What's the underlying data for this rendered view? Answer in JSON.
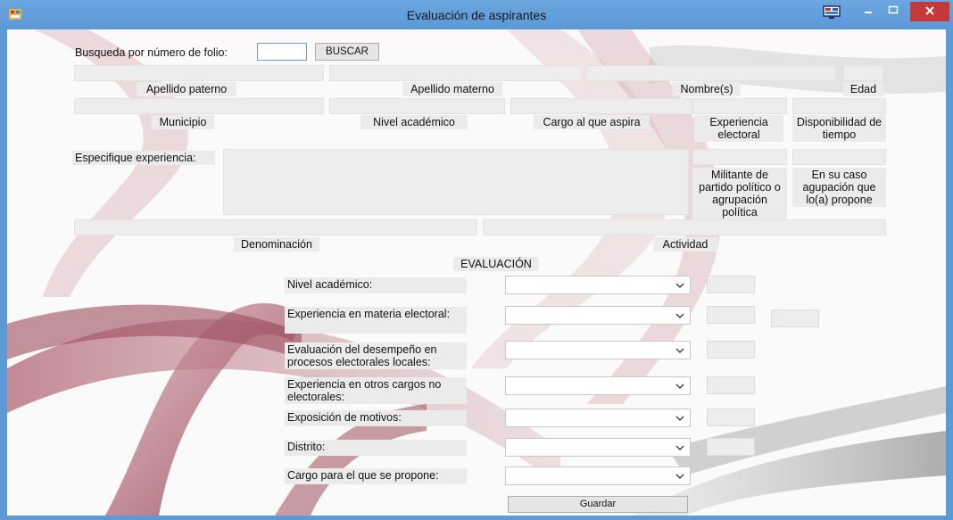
{
  "window": {
    "title": "Evaluación de aspirantes",
    "titlebar_color": "#5c9ad6",
    "close_color": "#c7383b"
  },
  "search": {
    "label": "Busqueda por número de folio:",
    "value": "",
    "button": "BUSCAR"
  },
  "fields": {
    "apellido_paterno": "Apellido paterno",
    "apellido_materno": "Apellido materno",
    "nombres": "Nombre(s)",
    "edad": "Edad",
    "municipio": "Municipio",
    "nivel_academico": "Nivel académico",
    "cargo_aspira": "Cargo al que aspira",
    "experiencia_electoral": "Experiencia electoral",
    "disponibilidad": "Disponibilidad de tiempo",
    "especifique": "Especifique experiencia:",
    "militante": "Militante de partido político o agrupación política",
    "agrupacion": "En su caso agupación que lo(a) propone",
    "denominacion": "Denominación",
    "actividad": "Actividad"
  },
  "evaluation": {
    "heading": "EVALUACIÓN",
    "rows": [
      {
        "label": "Nivel académico:",
        "selected": ""
      },
      {
        "label": "Experiencia en materia electoral:",
        "selected": ""
      },
      {
        "label": "Evaluación del desempeño en procesos electorales locales:",
        "selected": ""
      },
      {
        "label": "Experiencia en otros cargos no electorales:",
        "selected": ""
      },
      {
        "label": "Exposición de motivos:",
        "selected": ""
      },
      {
        "label": "Distrito:",
        "selected": ""
      },
      {
        "label": "Cargo para el que se propone:",
        "selected": ""
      }
    ],
    "save_button": "Guardar"
  }
}
